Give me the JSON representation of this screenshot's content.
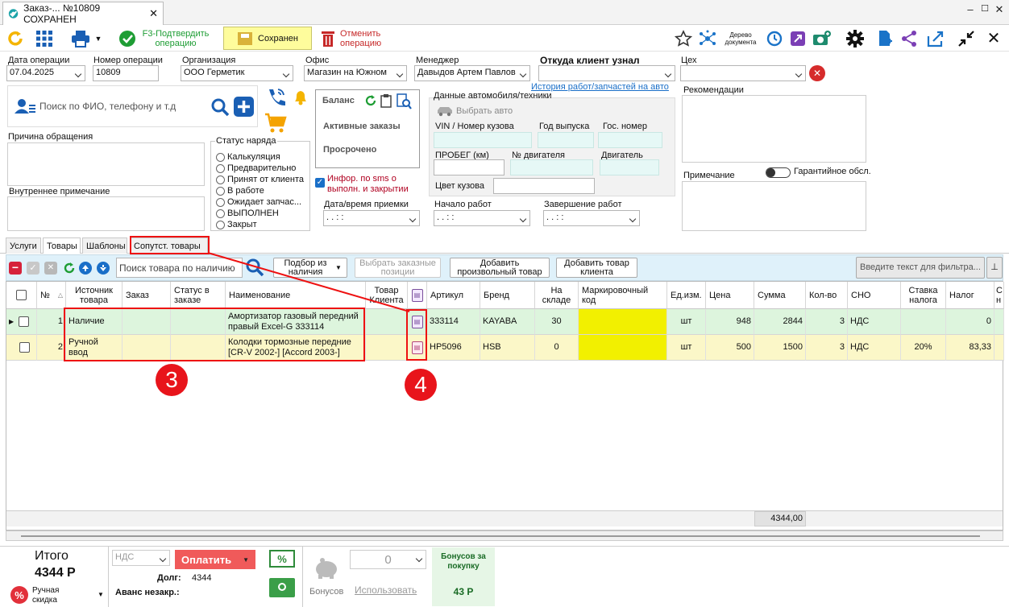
{
  "window": {
    "tab_title": "Заказ-... №10809 СОХРАНЕН",
    "close": "✕",
    "minimize": "–",
    "maximize": "☐",
    "win_close": "✕"
  },
  "toolbar": {
    "confirm_label": "F3-Подтвердить операцию",
    "saved_label": "Сохранен",
    "cancel_label": "Отменить операцию",
    "tree_label": "Дерево документа"
  },
  "form": {
    "date_label": "Дата операции",
    "date_value": "07.04.2025",
    "number_label": "Номер операции",
    "number_value": "10809",
    "org_label": "Организация",
    "org_value": "ООО Герметик",
    "office_label": "Офис",
    "office_value": "Магазин на Южном",
    "manager_label": "Менеджер",
    "manager_value": "Давыдов Артем Павлов",
    "source_label": "Откуда клиент узнал",
    "shop_label": "Цех",
    "history_link": "История работ/запчастей на авто",
    "search_placeholder": "Поиск по ФИО, телефону и т.д",
    "balance_label": "Баланс",
    "active_orders": "Активные заказы",
    "overdue": "Просрочено",
    "reason_label": "Причина  обращения",
    "internal_note_label": "Внутреннее примечание",
    "status_label": "Статус наряда",
    "statuses": [
      "Калькуляция",
      "Предварительно",
      "Принят от клиента",
      "В работе",
      "Ожидает запчас...",
      "ВЫПОЛНЕН",
      "Закрыт"
    ],
    "sms_label": "Инфор. по sms о выполн. и закрытии",
    "car_data_label": "Данные автомобиля/техники",
    "choose_car": "Выбрать авто",
    "vin_label": "VIN / Номер кузова",
    "year_label": "Год выпуска",
    "plate_label": "Гос. номер",
    "mileage_label": "ПРОБЕГ (км)",
    "engine_no_label": "№ двигателя",
    "engine_label": "Двигатель",
    "color_label": "Цвет кузова",
    "recommend_label": "Рекомендации",
    "note_label": "Примечание",
    "warranty_label": "Гарантийное обсл.",
    "receive_label": "Дата/время приемки",
    "receive_value": " .  .     :  :",
    "start_label": "Начало работ",
    "start_value": " .  .     :  :",
    "end_label": "Завершение работ",
    "end_value": " .  .     :  :"
  },
  "tabs": [
    "Услуги",
    "Товары",
    "Шаблоны",
    "Сопутст. товары"
  ],
  "grid_toolbar": {
    "search_placeholder": "Поиск товара по наличию",
    "pick_label": "Подбор из наличия",
    "choose_order_label": "Выбрать заказные позиции",
    "add_custom_label": "Добавить произвольный товар",
    "add_client_label": "Добавить товар клиента",
    "filter_placeholder": "Введите текст для фильтра..."
  },
  "columns": [
    "№",
    "Источник товара",
    "Заказ",
    "Статус в заказе",
    "Наименование",
    "Товар Клиента",
    "Артикул",
    "Бренд",
    "На складе",
    "Маркировочный код",
    "Ед.изм.",
    "Цена",
    "Сумма",
    "Кол-во",
    "СНО",
    "Ставка налога",
    "Налог",
    "С н"
  ],
  "rows": [
    {
      "num": "1",
      "source": "Наличие",
      "order": "",
      "status": "",
      "name": "Амортизатор газовый передний правый Excel-G 333114",
      "article": "333114",
      "brand": "KAYABA",
      "stock": "30",
      "unit": "шт",
      "price": "948",
      "sum": "2844",
      "qty": "3",
      "sno": "НДС",
      "rate": "",
      "tax": "0"
    },
    {
      "num": "2",
      "source": "Ручной ввод",
      "order": "",
      "status": "",
      "name": "Колодки тормозные передние [CR-V 2002-] [Accord 2003-]",
      "article": "HP5096",
      "brand": "HSB",
      "stock": "0",
      "unit": "шт",
      "price": "500",
      "sum": "1500",
      "qty": "3",
      "sno": "НДС",
      "rate": "20%",
      "tax": "83,33"
    }
  ],
  "grid_total": "4344,00",
  "annotations": {
    "badge3": "3",
    "badge4": "4"
  },
  "footer": {
    "total_label": "Итого",
    "total_value": "4344 Р",
    "discount_label": "Ручная скидка",
    "vat_value": "НДС",
    "pay_label": "Оплатить",
    "debt_label": "Долг:",
    "debt_value": "4344",
    "advance_label": "Аванс незакр.:",
    "bonus_value": "0",
    "bonus_label": "Бонусов",
    "use_label": "Использовать",
    "bonus_for_label": "Бонусов за покупку",
    "bonus_for_value": "43 Р"
  }
}
